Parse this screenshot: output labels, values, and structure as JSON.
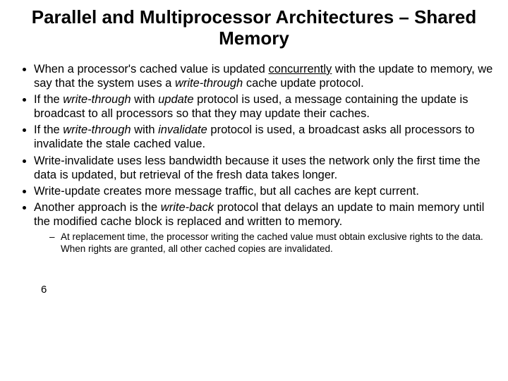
{
  "title": "Parallel and Multiprocessor Architectures – Shared Memory",
  "bullets": {
    "b1a": "When a processor's cached value is updated ",
    "b1b": "concurrently",
    "b1c": " with the update to memory, we say that the system uses a ",
    "b1d": "write-through",
    "b1e": " cache update protocol.",
    "b2a": "If the ",
    "b2b": "write-through",
    "b2c": " with ",
    "b2d": "update",
    "b2e": " protocol is used, a message containing the update is broadcast to all processors so that they may update their caches.",
    "b3a": "If the ",
    "b3b": "write-through",
    "b3c": " with ",
    "b3d": "invalidate",
    "b3e": " protocol is used, a broadcast asks all processors to invalidate the stale cached value.",
    "b4": "Write-invalidate uses less bandwidth because it uses the network only the first time the data is updated, but retrieval of the fresh data takes longer.",
    "b5": "Write-update creates more message traffic, but all caches are kept current.",
    "b6a": "Another approach is the ",
    "b6b": "write-back",
    "b6c": " protocol that delays an update to main memory until the modified cache block is replaced and written to memory.",
    "s1": "At replacement time, the processor writing the cached value must obtain exclusive rights to the data. When rights are granted, all other cached copies are invalidated."
  },
  "page": "6"
}
